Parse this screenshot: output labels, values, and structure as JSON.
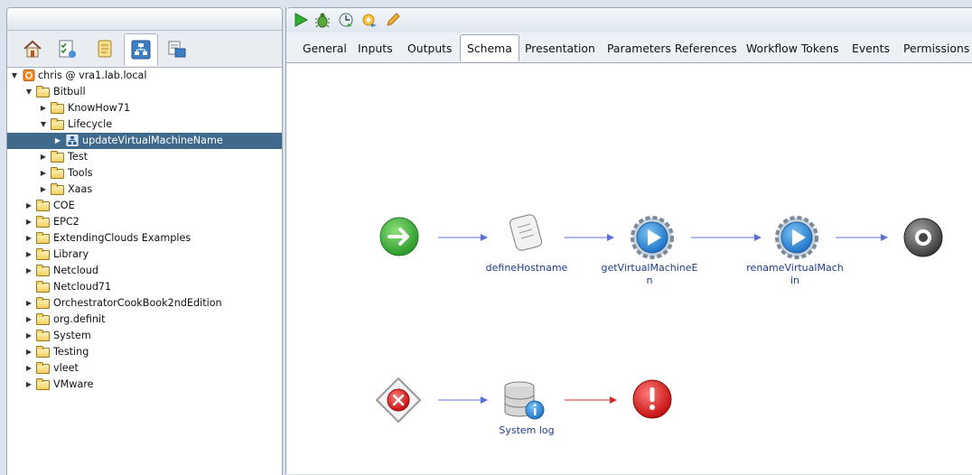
{
  "tree": {
    "root": "chris @ vra1.lab.local",
    "items": [
      {
        "label": "Bitbull"
      },
      {
        "label": "KnowHow71"
      },
      {
        "label": "Lifecycle"
      },
      {
        "label": "updateVirtualMachineName"
      },
      {
        "label": "Test"
      },
      {
        "label": "Tools"
      },
      {
        "label": "Xaas"
      },
      {
        "label": "COE"
      },
      {
        "label": "EPC2"
      },
      {
        "label": "ExtendingClouds Examples"
      },
      {
        "label": "Library"
      },
      {
        "label": "Netcloud"
      },
      {
        "label": "Netcloud71"
      },
      {
        "label": "OrchestratorCookBook2ndEdition"
      },
      {
        "label": "org.definit"
      },
      {
        "label": "System"
      },
      {
        "label": "Testing"
      },
      {
        "label": "vleet"
      },
      {
        "label": "VMware"
      }
    ]
  },
  "tabs": [
    "General",
    "Inputs",
    "Outputs",
    "Schema",
    "Presentation",
    "Parameters References",
    "Workflow Tokens",
    "Events",
    "Permissions"
  ],
  "schema": {
    "nodes": {
      "define": "defineHostname",
      "getvm": "getVirtualMachineEn",
      "rename": "renameVirtualMachin",
      "syslog": "System log"
    }
  },
  "colors": {
    "selection": "#3f6a8c",
    "link": "#1f3a8a",
    "arrow": "#5b6fd6",
    "error_arrow": "#d12a2a"
  }
}
